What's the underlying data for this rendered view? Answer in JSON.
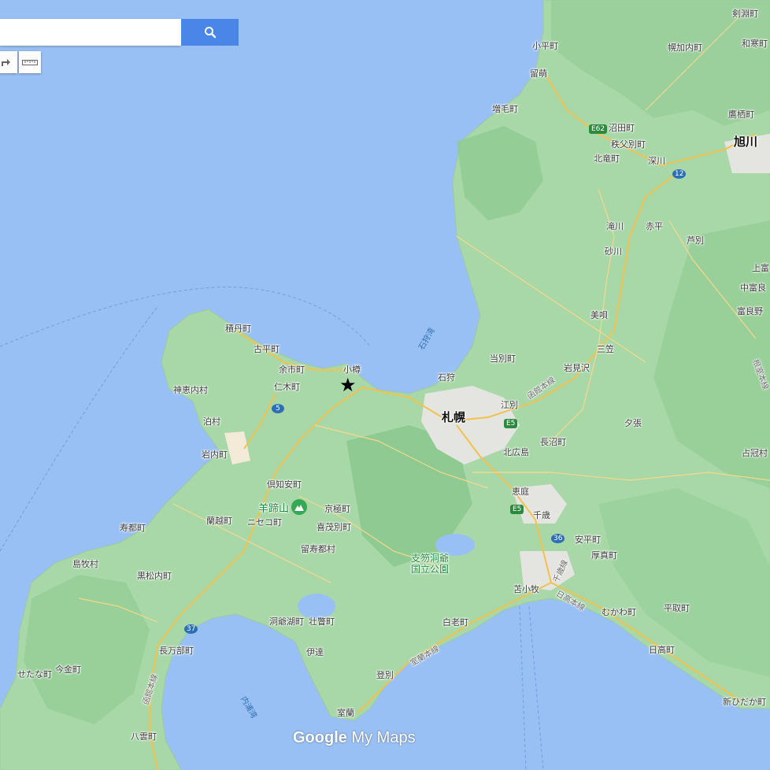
{
  "search": {
    "placeholder": ""
  },
  "tools": {
    "route_icon": "route-icon",
    "ruler_icon": "ruler-icon"
  },
  "marker": {
    "icon": "star-marker-icon"
  },
  "watermark": {
    "google": "Google",
    "mymaps": "My Maps"
  },
  "places": {
    "kenbuchi": "剣淵町",
    "wakkanai_like": "和寒町",
    "obira": "小平町",
    "horokanai": "幌加内町",
    "rumoi": "留萌",
    "mashike": "増毛町",
    "numata": "沼田町",
    "chippubetsu": "秩父別町",
    "hokuryu": "北竜町",
    "fukagawa": "深川",
    "takasu": "鷹栖町",
    "asahikawa": "旭川",
    "takikawa": "滝川",
    "akabira": "赤平",
    "sunagawa": "砂川",
    "ashibetsu": "芦別",
    "kamifurano": "上富",
    "nakafurano": "中富良",
    "furano": "富良野",
    "bibai": "美唄",
    "mikasa": "三笠",
    "iwamizawa": "岩見沢",
    "yubari": "夕張",
    "shimukappu": "占冠村",
    "tobetsu": "当別町",
    "ishikari": "石狩",
    "sapporo": "札幌",
    "ebetsu": "江別",
    "naganuma": "長沼町",
    "kitahiroshima": "北広島",
    "eniwa": "恵庭",
    "chitose": "千歳",
    "abira": "安平町",
    "atsuma": "厚真町",
    "tomakomai": "苫小牧",
    "mukawa": "むかわ町",
    "hiratori": "平取町",
    "hidaka": "日高町",
    "shinhidaka": "新ひだか町",
    "shiraoi": "白老町",
    "noboribetsu": "登別",
    "muroran": "室蘭",
    "date": "伊達",
    "sobetsu": "壮瞥町",
    "toyako": "洞爺湖町",
    "rusutsu": "留寿都村",
    "kimobetsu": "喜茂別町",
    "kyogoku": "京極町",
    "kutchan": "倶知安町",
    "niseko": "ニセコ町",
    "rankoshi": "蘭越町",
    "yotei": "羊蹄山",
    "shakotan": "積丹町",
    "furubira": "古平町",
    "yoichi": "余市町",
    "niki": "仁木町",
    "kamoenai": "神恵内村",
    "tomari": "泊村",
    "iwanai": "岩内町",
    "otaru": "小樽",
    "suttsu": "寿都町",
    "shimamaki": "島牧村",
    "kuromatsunai": "黒松内町",
    "oshamambe": "長万部町",
    "setana": "せたな町",
    "imakane": "今金町",
    "yakumo": "八雲町",
    "park": "支笏洞爺\n国立公園",
    "ishikari_bay": "石狩湾",
    "uchiura_bay": "内浦湾"
  },
  "rail": {
    "hakodate_main_a": "函館本線",
    "hakodate_main_b": "函館本線",
    "nemuro_main": "根室本線",
    "chitose_line": "千歳線",
    "muroran_line": "室蘭本線",
    "hidaka_line": "日高本線"
  },
  "routes": {
    "e62": "E62",
    "r12": "12",
    "e5a": "E5",
    "e5b": "E5",
    "r5": "5",
    "r36": "36",
    "r37": "37"
  }
}
